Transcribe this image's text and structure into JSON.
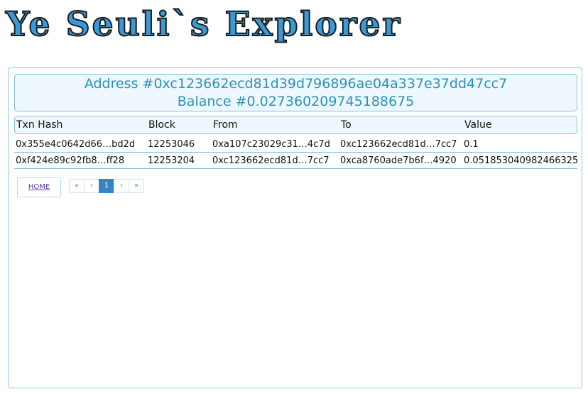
{
  "logo": "Ye Seuli`s Explorer",
  "header": {
    "address_line": "Address #0xc123662ecd81d39d796896ae04a337e37dd47cc7",
    "balance_line": "Balance #0.027360209745188675"
  },
  "table": {
    "columns": [
      "Txn Hash",
      "Block",
      "From",
      "To",
      "Value"
    ],
    "rows": [
      [
        "0x355e4c0642d66…bd2d",
        "12253046",
        "0xa107c23029c31…4c7d",
        "0xc123662ecd81d…7cc7",
        "0.1"
      ],
      [
        "0xf424e89c92fb8…ff28",
        "12253204",
        "0xc123662ecd81d…7cc7",
        "0xca8760ade7b6f…4920",
        "0.051853040982466325"
      ]
    ]
  },
  "home_label": "HOME",
  "pagination": {
    "first": "«",
    "prev": "‹",
    "current": "1",
    "next": "›",
    "last": "»"
  },
  "colors": {
    "accent": "#3a9ad9",
    "header_text": "#2a93b6",
    "border": "#7fc0da",
    "active_page": "#3a83c2"
  }
}
